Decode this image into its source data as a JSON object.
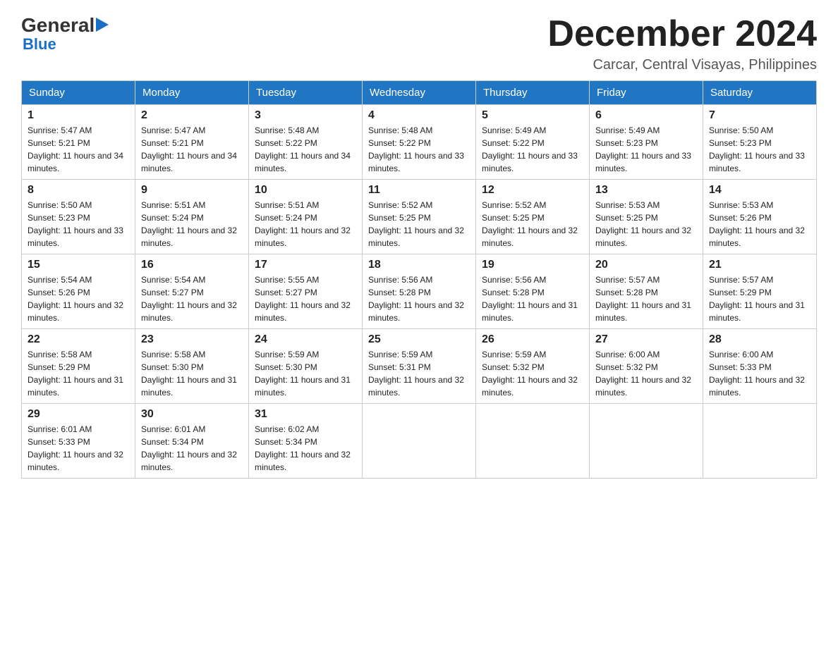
{
  "logo": {
    "general": "General",
    "blue": "Blue"
  },
  "title": {
    "month_year": "December 2024",
    "location": "Carcar, Central Visayas, Philippines"
  },
  "calendar": {
    "headers": [
      "Sunday",
      "Monday",
      "Tuesday",
      "Wednesday",
      "Thursday",
      "Friday",
      "Saturday"
    ],
    "weeks": [
      [
        {
          "day": "1",
          "sunrise": "5:47 AM",
          "sunset": "5:21 PM",
          "daylight": "11 hours and 34 minutes."
        },
        {
          "day": "2",
          "sunrise": "5:47 AM",
          "sunset": "5:21 PM",
          "daylight": "11 hours and 34 minutes."
        },
        {
          "day": "3",
          "sunrise": "5:48 AM",
          "sunset": "5:22 PM",
          "daylight": "11 hours and 34 minutes."
        },
        {
          "day": "4",
          "sunrise": "5:48 AM",
          "sunset": "5:22 PM",
          "daylight": "11 hours and 33 minutes."
        },
        {
          "day": "5",
          "sunrise": "5:49 AM",
          "sunset": "5:22 PM",
          "daylight": "11 hours and 33 minutes."
        },
        {
          "day": "6",
          "sunrise": "5:49 AM",
          "sunset": "5:23 PM",
          "daylight": "11 hours and 33 minutes."
        },
        {
          "day": "7",
          "sunrise": "5:50 AM",
          "sunset": "5:23 PM",
          "daylight": "11 hours and 33 minutes."
        }
      ],
      [
        {
          "day": "8",
          "sunrise": "5:50 AM",
          "sunset": "5:23 PM",
          "daylight": "11 hours and 33 minutes."
        },
        {
          "day": "9",
          "sunrise": "5:51 AM",
          "sunset": "5:24 PM",
          "daylight": "11 hours and 32 minutes."
        },
        {
          "day": "10",
          "sunrise": "5:51 AM",
          "sunset": "5:24 PM",
          "daylight": "11 hours and 32 minutes."
        },
        {
          "day": "11",
          "sunrise": "5:52 AM",
          "sunset": "5:25 PM",
          "daylight": "11 hours and 32 minutes."
        },
        {
          "day": "12",
          "sunrise": "5:52 AM",
          "sunset": "5:25 PM",
          "daylight": "11 hours and 32 minutes."
        },
        {
          "day": "13",
          "sunrise": "5:53 AM",
          "sunset": "5:25 PM",
          "daylight": "11 hours and 32 minutes."
        },
        {
          "day": "14",
          "sunrise": "5:53 AM",
          "sunset": "5:26 PM",
          "daylight": "11 hours and 32 minutes."
        }
      ],
      [
        {
          "day": "15",
          "sunrise": "5:54 AM",
          "sunset": "5:26 PM",
          "daylight": "11 hours and 32 minutes."
        },
        {
          "day": "16",
          "sunrise": "5:54 AM",
          "sunset": "5:27 PM",
          "daylight": "11 hours and 32 minutes."
        },
        {
          "day": "17",
          "sunrise": "5:55 AM",
          "sunset": "5:27 PM",
          "daylight": "11 hours and 32 minutes."
        },
        {
          "day": "18",
          "sunrise": "5:56 AM",
          "sunset": "5:28 PM",
          "daylight": "11 hours and 32 minutes."
        },
        {
          "day": "19",
          "sunrise": "5:56 AM",
          "sunset": "5:28 PM",
          "daylight": "11 hours and 31 minutes."
        },
        {
          "day": "20",
          "sunrise": "5:57 AM",
          "sunset": "5:28 PM",
          "daylight": "11 hours and 31 minutes."
        },
        {
          "day": "21",
          "sunrise": "5:57 AM",
          "sunset": "5:29 PM",
          "daylight": "11 hours and 31 minutes."
        }
      ],
      [
        {
          "day": "22",
          "sunrise": "5:58 AM",
          "sunset": "5:29 PM",
          "daylight": "11 hours and 31 minutes."
        },
        {
          "day": "23",
          "sunrise": "5:58 AM",
          "sunset": "5:30 PM",
          "daylight": "11 hours and 31 minutes."
        },
        {
          "day": "24",
          "sunrise": "5:59 AM",
          "sunset": "5:30 PM",
          "daylight": "11 hours and 31 minutes."
        },
        {
          "day": "25",
          "sunrise": "5:59 AM",
          "sunset": "5:31 PM",
          "daylight": "11 hours and 32 minutes."
        },
        {
          "day": "26",
          "sunrise": "5:59 AM",
          "sunset": "5:32 PM",
          "daylight": "11 hours and 32 minutes."
        },
        {
          "day": "27",
          "sunrise": "6:00 AM",
          "sunset": "5:32 PM",
          "daylight": "11 hours and 32 minutes."
        },
        {
          "day": "28",
          "sunrise": "6:00 AM",
          "sunset": "5:33 PM",
          "daylight": "11 hours and 32 minutes."
        }
      ],
      [
        {
          "day": "29",
          "sunrise": "6:01 AM",
          "sunset": "5:33 PM",
          "daylight": "11 hours and 32 minutes."
        },
        {
          "day": "30",
          "sunrise": "6:01 AM",
          "sunset": "5:34 PM",
          "daylight": "11 hours and 32 minutes."
        },
        {
          "day": "31",
          "sunrise": "6:02 AM",
          "sunset": "5:34 PM",
          "daylight": "11 hours and 32 minutes."
        },
        null,
        null,
        null,
        null
      ]
    ]
  }
}
